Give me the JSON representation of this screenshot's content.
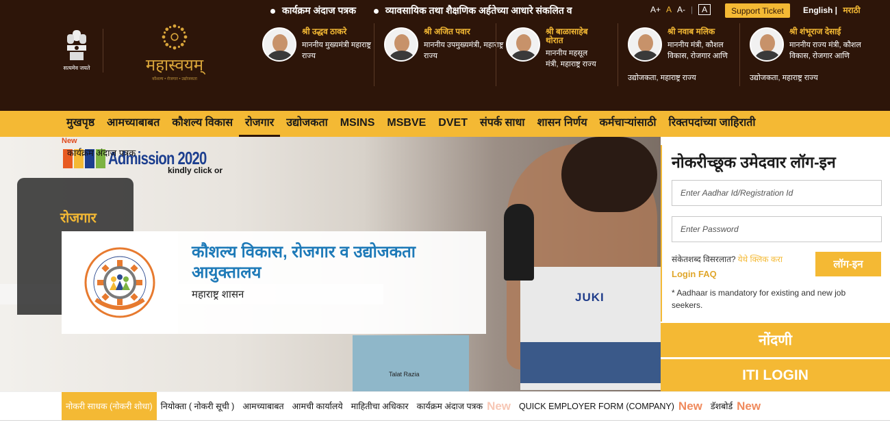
{
  "header": {
    "ticker": [
      "कार्यक्रम अंदाज पत्रक",
      "व्यावसायिक तथा शैक्षणिक अर्हतेच्या आधारे संकलित व"
    ],
    "font_controls": [
      "A+",
      "A",
      "A-",
      "A"
    ],
    "support_label": "Support Ticket",
    "lang_en": "English",
    "lang_mr": "मराठी",
    "emblem_caption": "सत्यमेव जयते",
    "logo_name": "महास्वयम्",
    "logo_sub": "कौशल्य • रोजगार • उद्योजकता"
  },
  "ministers": [
    {
      "name": "श्री उद्धव ठाकरे",
      "role": "माननीय मुख्यमंत्री महाराष्ट्र राज्य",
      "extra": ""
    },
    {
      "name": "श्री अजित पवार",
      "role": "माननीय उपमुख्यमंत्री, महाराष्ट्र राज्य",
      "extra": ""
    },
    {
      "name": "श्री बाळासाहेब थोरात",
      "role": "माननीय महसूल मंत्री, महाराष्ट्र राज्य",
      "extra": ""
    },
    {
      "name": "श्री नवाब मलिक",
      "role": "माननीय मंत्री, कौशल विकास, रोजगार आणि",
      "extra": "उद्योजकता,             महाराष्ट्र राज्य"
    },
    {
      "name": "श्री शंभूराज देसाई",
      "role": "माननीय राज्य मंत्री, कौशल विकास, रोजगार आणि",
      "extra": "उद्योजकता,             महाराष्ट्र राज्य"
    }
  ],
  "nav": [
    "मुखपृष्ठ",
    "आमच्याबाबत",
    "कौशल्य विकास",
    "रोजगार",
    "उद्योजकता",
    "MSINS",
    "MSBVE",
    "DVET",
    "संपर्क साधा",
    "शासन निर्णय",
    "कर्मचाऱ्यांसाठी",
    "रिक्तपदांच्या जाहिराती"
  ],
  "nav_active": "रोजगार",
  "hero": {
    "admission_new": "New",
    "admission_text": "Admission 2020",
    "admission_overlay": "कार्यक्रम अंदाज पत्रक",
    "kindly": "kindly click or",
    "section_title": "रोजगार",
    "dept_title": "कौशल्य विकास, रोजगार व उद्योजकता आयुक्तालय",
    "dept_sub": "महाराष्ट्र शासन",
    "juki": "JUKI",
    "card_name": "Talat Razia"
  },
  "login": {
    "title": "नोकरीच्छूक उमेदवार लॉग-इन",
    "aadhar_placeholder": "Enter Aadhar Id/Registration Id",
    "password_placeholder": "Enter Password",
    "forgot_text": "संकेतशब्द विसरलात?",
    "forgot_link": "येथे क्लिक करा",
    "faq": "Login FAQ",
    "login_btn": "लॉग-इन",
    "note": "* Aadhaar is mandatory for existing and new job seekers."
  },
  "buttons": {
    "register": "नोंदणी",
    "iti_login": "ITI LOGIN"
  },
  "bottom_tabs": [
    {
      "label": "नोकरी साधक (नोकरी शोधा)",
      "new": ""
    },
    {
      "label": "नियोक्ता ( नोकरी सूची )",
      "new": ""
    },
    {
      "label": "आमच्याबाबत",
      "new": ""
    },
    {
      "label": "आमची कार्यालये",
      "new": ""
    },
    {
      "label": "माहितीचा अधिकार",
      "new": ""
    },
    {
      "label": "कार्यक्रम अंदाज पत्रक",
      "new": "New"
    },
    {
      "label": "QUICK EMPLOYER FORM (COMPANY)",
      "new": "New"
    },
    {
      "label": "डॅशबोर्ड",
      "new": "New"
    }
  ],
  "colors": {
    "brand_dark": "#2d1509",
    "accent": "#f4b934",
    "dept_blue": "#1e7ab8"
  }
}
